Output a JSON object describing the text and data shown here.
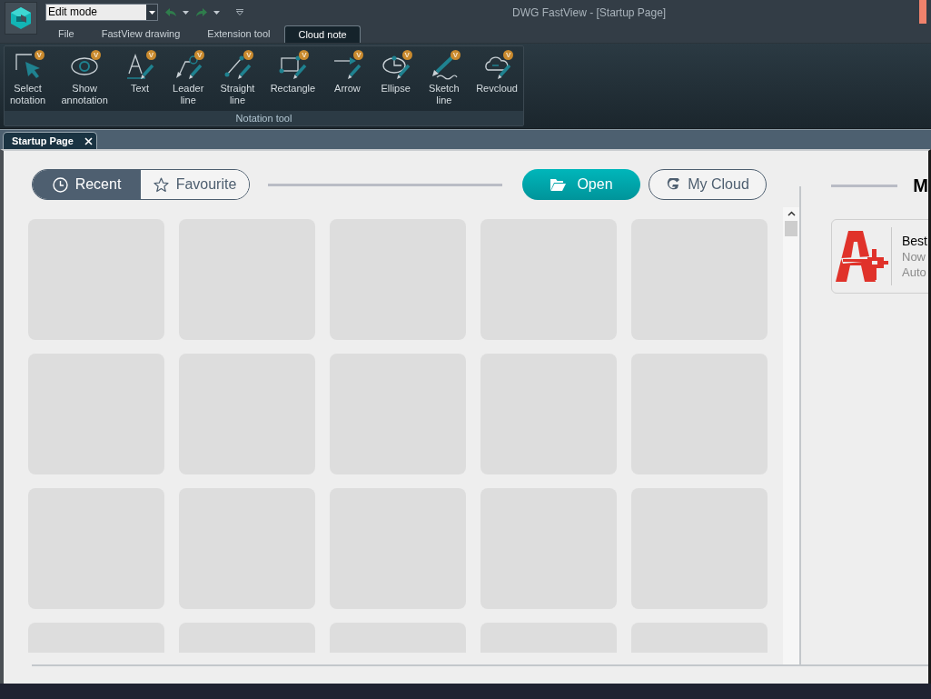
{
  "window": {
    "title": "DWG FastView - [Startup Page]"
  },
  "quick_access": {
    "mode_select": {
      "value": "Edit mode"
    }
  },
  "menu_tabs": [
    {
      "label": "File",
      "selected": false
    },
    {
      "label": "FastView drawing",
      "selected": false
    },
    {
      "label": "Extension tool",
      "selected": false
    },
    {
      "label": "Cloud note",
      "selected": true
    }
  ],
  "ribbon": {
    "groups": [
      {
        "label": "Notation tool",
        "tools": [
          {
            "kind": "select",
            "label": "Select\nnotation",
            "badge": "V"
          },
          {
            "kind": "show",
            "label": "Show\nannotation",
            "badge": "V"
          },
          {
            "kind": "text",
            "label": "Text",
            "badge": "V"
          },
          {
            "kind": "leader",
            "label": "Leader\nline",
            "badge": "V"
          },
          {
            "kind": "straight",
            "label": "Straight\nline",
            "badge": "V"
          },
          {
            "kind": "rectangle",
            "label": "Rectangle",
            "badge": "V"
          },
          {
            "kind": "arrow",
            "label": "Arrow",
            "badge": "V"
          },
          {
            "kind": "ellipse",
            "label": "Ellipse",
            "badge": "V"
          },
          {
            "kind": "sketch",
            "label": "Sketch\nline",
            "badge": "V"
          },
          {
            "kind": "revcloud",
            "label": "Revcloud",
            "badge": "V"
          }
        ]
      }
    ]
  },
  "document_tabs": [
    {
      "label": "Startup Page",
      "selected": true
    }
  ],
  "startup": {
    "filter_tabs": [
      {
        "kind": "recent",
        "label": "Recent",
        "selected": true
      },
      {
        "kind": "favourite",
        "label": "Favourite",
        "selected": false
      }
    ],
    "actions": [
      {
        "kind": "open",
        "label": "Open"
      },
      {
        "kind": "cloud",
        "label": "My Cloud"
      }
    ],
    "side_panel": {
      "heading": "M",
      "promo": {
        "title": "Best",
        "lines": [
          "Now",
          "Auto"
        ]
      }
    }
  }
}
